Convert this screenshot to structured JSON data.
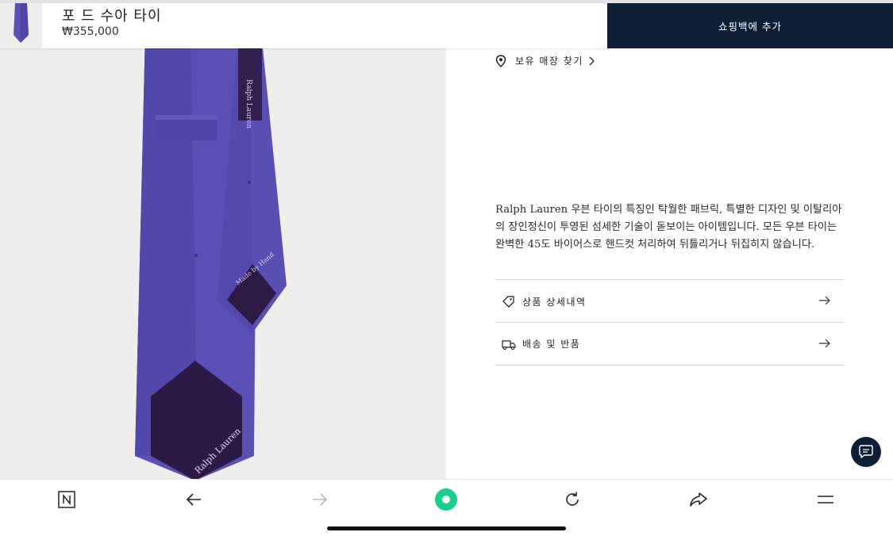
{
  "product": {
    "title": "포 드 수아 타이",
    "price": "₩355,000",
    "image_label": "Ralph Lauren silk tie",
    "tie_color": "#5a4fb0",
    "tie_tip_color": "#2e1b45"
  },
  "actions": {
    "add_to_bag": "쇼핑백에 추가",
    "find_store": "보유 매장 찾기"
  },
  "details": {
    "description": "Ralph Lauren 우븐 타이의 특징인 탁월한 패브릭, 특별한 디자인 및 이탈리아의 장인정신이 투영된 섬세한 기술이 돋보이는 아이템입니다. 모든 우븐 타이는 완벽한 45도 바이어스로 핸드컷 처리하여 뒤틀리거나 뒤집히지 않습니다.",
    "accordion": [
      {
        "label": "상품 상세내역",
        "icon": "tag-icon"
      },
      {
        "label": "배송 및 반품",
        "icon": "truck-icon"
      }
    ]
  },
  "toolbar": {
    "items": [
      "n-home-icon",
      "back-arrow-icon",
      "forward-arrow-icon",
      "record-icon",
      "reload-icon",
      "share-icon",
      "menu-icon"
    ],
    "accent": "#18d08c"
  },
  "colors": {
    "navy": "#0e1e36",
    "image_bg": "#efeeec"
  }
}
